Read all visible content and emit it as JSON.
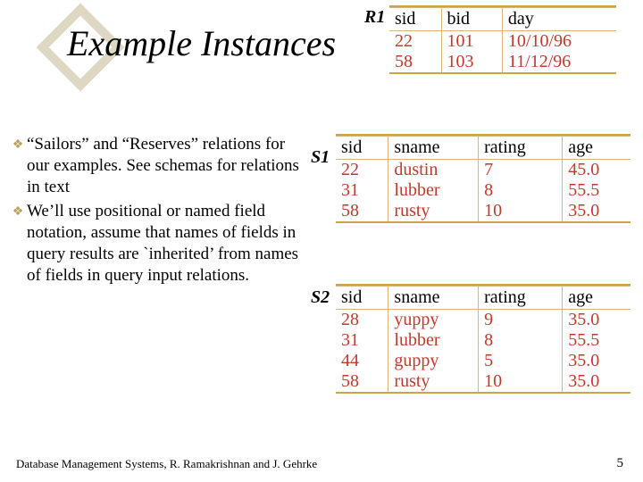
{
  "title": "Example Instances",
  "bullets": {
    "b1": "“Sailors” and “Reserves” relations for our examples. See schemas for relations in text",
    "b2": "We’ll use positional or named field notation, assume that names of fields in query results are `inherited’ from names of fields in query input relations."
  },
  "labels": {
    "r1": "R1",
    "s1": "S1",
    "s2": "S2"
  },
  "r1": {
    "h": {
      "c1": "sid",
      "c2": "bid",
      "c3": "day"
    },
    "r": [
      {
        "c1": "22",
        "c2": "101",
        "c3": "10/10/96"
      },
      {
        "c1": "58",
        "c2": "103",
        "c3": "11/12/96"
      }
    ]
  },
  "s1": {
    "h": {
      "c1": "sid",
      "c2": "sname",
      "c3": "rating",
      "c4": "age"
    },
    "r": [
      {
        "c1": "22",
        "c2": "dustin",
        "c3": "7",
        "c4": "45.0"
      },
      {
        "c1": "31",
        "c2": "lubber",
        "c3": "8",
        "c4": "55.5"
      },
      {
        "c1": "58",
        "c2": "rusty",
        "c3": "10",
        "c4": "35.0"
      }
    ]
  },
  "s2": {
    "h": {
      "c1": "sid",
      "c2": "sname",
      "c3": "rating",
      "c4": "age"
    },
    "r": [
      {
        "c1": "28",
        "c2": "yuppy",
        "c3": "9",
        "c4": "35.0"
      },
      {
        "c1": "31",
        "c2": "lubber",
        "c3": "8",
        "c4": "55.5"
      },
      {
        "c1": "44",
        "c2": "guppy",
        "c3": "5",
        "c4": "35.0"
      },
      {
        "c1": "58",
        "c2": "rusty",
        "c3": "10",
        "c4": "35.0"
      }
    ]
  },
  "footer": "Database Management Systems, R. Ramakrishnan and J. Gehrke",
  "pagenum": "5"
}
